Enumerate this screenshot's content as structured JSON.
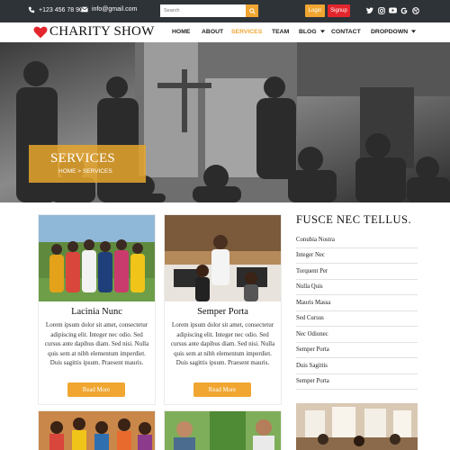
{
  "topbar": {
    "phone": "+123 456 78 90",
    "email": "info@gmail.com",
    "search_placeholder": "Search",
    "login_label": "Login",
    "signup_label": "Signup",
    "login_color": "#f0a631",
    "signup_color": "#e3262d",
    "social_icons": [
      "twitter-icon",
      "instagram-icon",
      "youtube-icon",
      "google-icon",
      "dribbble-icon"
    ]
  },
  "brand": {
    "name": "CHARITY SHOW",
    "heart_color": "#e3262d"
  },
  "nav": {
    "items": [
      "HOME",
      "ABOUT",
      "SERVICES",
      "TEAM",
      "BLOG",
      "CONTACT",
      "DROPDOWN"
    ],
    "active": "SERVICES",
    "accent": "#f0a631"
  },
  "hero": {
    "title": "SERVICES",
    "breadcrumb": "HOME > SERVICES"
  },
  "cards": [
    {
      "title": "Lacinia Nunc",
      "text": "Lorem ipsum dolor sit amet, consectetur adipiscing elit. Integer nec odio. Sed cursus ante dapibus diam. Sed nisi. Nulla quis sem at nibh elementum imperdiet. Duis sagittis ipsum. Praesent mauris.",
      "button": "Read More"
    },
    {
      "title": "Semper Porta",
      "text": "Lorem ipsum dolor sit amet, consectetur adipiscing elit. Integer nec odio. Sed cursus ante dapibus diam. Sed nisi. Nulla quis sem at nibh elementum imperdiet. Duis sagittis ipsum. Praesent mauris.",
      "button": "Read More"
    }
  ],
  "sidebar": {
    "title": "FUSCE NEC TELLUS.",
    "items": [
      "Conubia Nostra",
      "Integer Nec",
      "Torquent Per",
      "Nulla Quis",
      "Mauris Massa",
      "Sed Cursus",
      "Nec Odionec",
      "Semper Porta",
      "Duis Sagittis",
      "Semper Porta"
    ]
  }
}
